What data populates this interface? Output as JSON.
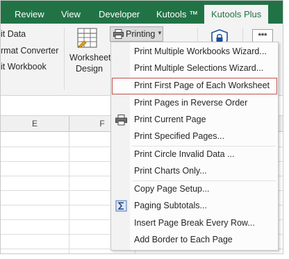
{
  "ribbon_tabs": [
    {
      "label": "Review"
    },
    {
      "label": "View"
    },
    {
      "label": "Developer"
    },
    {
      "label": "Kutools ™"
    },
    {
      "label": "Kutools Plus"
    }
  ],
  "ribbon": {
    "left_items": [
      "it Data",
      "rmat Converter",
      "it Workbook"
    ],
    "worksheet_design": {
      "line1": "Worksheet",
      "line2": "Design"
    },
    "printing_label": "Printing",
    "dots_label": "***"
  },
  "columns": [
    "E",
    "F"
  ],
  "menu": {
    "items": [
      {
        "label": "Print Multiple Workbooks Wizard...",
        "icon": "none"
      },
      {
        "label": "Print Multiple Selections Wizard...",
        "icon": "none"
      },
      {
        "label": "Print First Page of Each Worksheet",
        "icon": "none",
        "highlighted": true
      },
      {
        "label": "Print Pages in Reverse Order",
        "icon": "none"
      },
      {
        "label": "Print Current Page",
        "icon": "printer-icon"
      },
      {
        "label": "Print Specified Pages...",
        "icon": "none"
      },
      {
        "label": "Print Circle Invalid Data ...",
        "icon": "none"
      },
      {
        "label": "Print Charts Only...",
        "icon": "none"
      },
      {
        "label": "Copy Page Setup...",
        "icon": "none"
      },
      {
        "label": "Paging Subtotals...",
        "icon": "sigma-icon"
      },
      {
        "label": "Insert Page Break Every Row...",
        "icon": "none"
      },
      {
        "label": "Add Border to Each Page",
        "icon": "none"
      }
    ]
  },
  "colors": {
    "ribbon_green": "#217346",
    "highlight_border": "#c0504d"
  }
}
